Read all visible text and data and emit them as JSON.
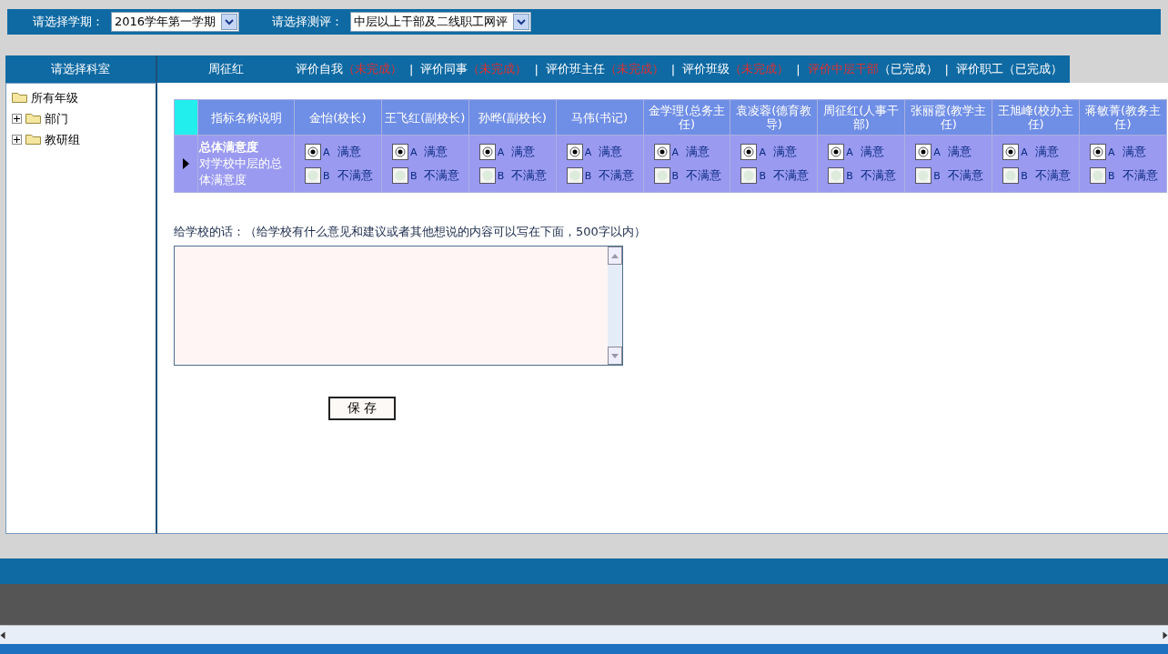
{
  "top_bar": {
    "semester_label": "请选择学期：",
    "semester_value": "2016学年第一学期",
    "survey_label": "请选择测评：",
    "survey_value": "中层以上干部及二线职工网评"
  },
  "sidebar": {
    "title": "请选择科室",
    "tree": [
      {
        "label": "所有年级",
        "expanded": true,
        "children": [
          {
            "label": "部门",
            "expanded": false
          },
          {
            "label": "教研组",
            "expanded": false
          }
        ]
      }
    ]
  },
  "header": {
    "user": "周征红",
    "separator": "|",
    "tabs": [
      {
        "label": "评价自我",
        "status": "（未完成）",
        "done": false,
        "selected": false
      },
      {
        "label": "评价同事",
        "status": "（未完成）",
        "done": false,
        "selected": false
      },
      {
        "label": "评价班主任",
        "status": "（未完成）",
        "done": false,
        "selected": false
      },
      {
        "label": "评价班级",
        "status": "（未完成）",
        "done": false,
        "selected": false
      },
      {
        "label": "评价中层干部",
        "status": "（已完成）",
        "done": true,
        "selected": true
      },
      {
        "label": "评价职工",
        "status": "（已完成）",
        "done": true,
        "selected": false
      }
    ]
  },
  "table": {
    "first_column": "指标名称说明",
    "row_title": "总体满意度",
    "row_description": "对学校中层的总体满意度",
    "people": [
      {
        "name": "金怡(校长)",
        "options": [
          {
            "letter": "A",
            "label": "满意",
            "selected": true
          },
          {
            "letter": "B",
            "label": "不满意",
            "selected": false
          }
        ]
      },
      {
        "name": "王飞红(副校长)",
        "options": [
          {
            "letter": "A",
            "label": "满意",
            "selected": true
          },
          {
            "letter": "B",
            "label": "不满意",
            "selected": false
          }
        ]
      },
      {
        "name": "孙晔(副校长)",
        "options": [
          {
            "letter": "A",
            "label": "满意",
            "selected": true
          },
          {
            "letter": "B",
            "label": "不满意",
            "selected": false
          }
        ]
      },
      {
        "name": "马伟(书记)",
        "options": [
          {
            "letter": "A",
            "label": "满意",
            "selected": true
          },
          {
            "letter": "B",
            "label": "不满意",
            "selected": false
          }
        ]
      },
      {
        "name": "金学理(总务主任)",
        "options": [
          {
            "letter": "A",
            "label": "满意",
            "selected": true
          },
          {
            "letter": "B",
            "label": "不满意",
            "selected": false
          }
        ]
      },
      {
        "name": "袁凌蓉(德育教导)",
        "options": [
          {
            "letter": "A",
            "label": "满意",
            "selected": true
          },
          {
            "letter": "B",
            "label": "不满意",
            "selected": false
          }
        ]
      },
      {
        "name": "周征红(人事干部)",
        "options": [
          {
            "letter": "A",
            "label": "满意",
            "selected": true
          },
          {
            "letter": "B",
            "label": "不满意",
            "selected": false
          }
        ]
      },
      {
        "name": "张丽霞(教学主任)",
        "options": [
          {
            "letter": "A",
            "label": "满意",
            "selected": true
          },
          {
            "letter": "B",
            "label": "不满意",
            "selected": false
          }
        ]
      },
      {
        "name": "王旭峰(校办主任)",
        "options": [
          {
            "letter": "A",
            "label": "满意",
            "selected": true
          },
          {
            "letter": "B",
            "label": "不满意",
            "selected": false
          }
        ]
      },
      {
        "name": "蒋敏菁(教务主任)",
        "options": [
          {
            "letter": "A",
            "label": "满意",
            "selected": true
          },
          {
            "letter": "B",
            "label": "不满意",
            "selected": false
          }
        ]
      }
    ]
  },
  "comment": {
    "label": "给学校的话：（给学校有什么意见和建议或者其他想说的内容可以写在下面，500字以内）"
  },
  "save_button": "保 存"
}
